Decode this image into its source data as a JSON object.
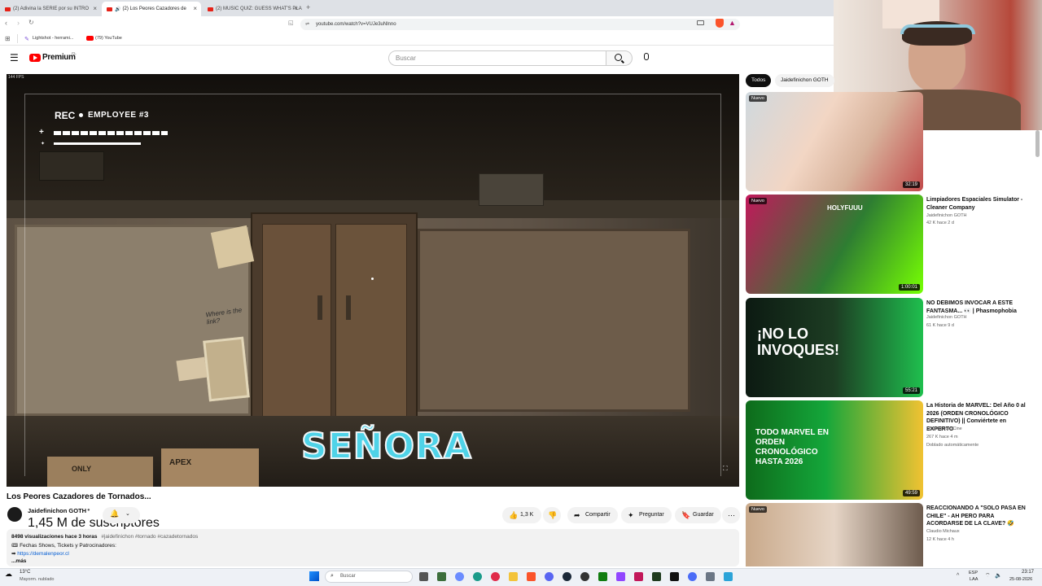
{
  "browser": {
    "tabs": [
      {
        "title": "(2) Adivina la SERIE por su INTRO"
      },
      {
        "title": "(2) Los Peores Cazadores de"
      },
      {
        "title": "(2) MUSIC QUIZ: GUESS WHAT'S PLA"
      }
    ],
    "url": "youtube.com/watch?v=VUJe3uNlnno",
    "bookmarks": [
      "Lightshot - herrami...",
      "(79) YouTube"
    ]
  },
  "youtube": {
    "logo_text": "Premium",
    "logo_region": "CL",
    "search_placeholder": "Buscar"
  },
  "player": {
    "fps": "144 FPS",
    "rec_label": "REC",
    "employee_label": "EMPLOYEE #3",
    "caption": "SEÑORA",
    "poster_text": "Where is the link?",
    "box_text_1": "APEX",
    "box_text_2": "ONLY"
  },
  "video": {
    "title": "Los Peores Cazadores de Tornados...",
    "channel": "Jaidefinichon GOTH",
    "subscribers": "1,45 M de suscriptores",
    "likes": "1,3 K",
    "share": "Compartir",
    "ask": "Preguntar",
    "save": "Guardar",
    "views_time": "8498 visualizaciones  hace 3 horas",
    "hashtags": "#jaidefinichon #tornado #cazadetornados",
    "desc_line1": "Fechas Shows, Tickets y Patrocinadores:",
    "desc_link": "https://demalenpeor.cl",
    "more": "...más"
  },
  "sidebar": {
    "chips": [
      "Todos",
      "Jaidefinichon GOTH"
    ],
    "items": [
      {
        "title": "",
        "channel": "",
        "stats": "",
        "duration": "32:19",
        "badge": "Nuevo"
      },
      {
        "title": "Limpiadores Espaciales Simulator - Cleaner Company",
        "channel": "Jaidefinichon GOTH",
        "stats": "42 K  hace 2 d",
        "duration": "1:00:01",
        "badge": "Nuevo",
        "thumb_text": "HOLYFUUU"
      },
      {
        "title": "NO DEBIMOS INVOCAR A ESTE FANTASMA... 👀 | Phasmophobia",
        "channel": "Jaidefinichon GOTH",
        "stats": "61 K  hace 9 d",
        "duration": "55:21",
        "badge": "",
        "thumb_text": "¡NO LO INVOQUES!"
      },
      {
        "title": "La Historia de MARVEL: Del Año 0 al 2026 (ORDEN CRONOLÓGICO DEFINITIVO) || Conviértete en EXPERTO",
        "channel": "Lo Chido del Cine",
        "stats": "267 K  hace 4 m",
        "extra": "Doblado automáticamente",
        "duration": "49:59",
        "badge": "",
        "thumb_text": "TODO MARVEL EN ORDEN CRONOLÓGICO HASTA 2026"
      },
      {
        "title": "REACCIONANDO A \"SOLO PASA EN CHILE\" - AH PERO PARA ACORDARSE DE LA CLAVE? 🤣",
        "channel": "Claudio Michaux",
        "stats": "12 K  hace 4 h",
        "duration": "",
        "badge": "Nuevo"
      }
    ]
  },
  "taskbar": {
    "weather_temp": "13°C",
    "weather_desc": "Mayorm. nublado",
    "search": "Buscar",
    "lang": "ESP",
    "lang2": "LAA",
    "time": "23:17",
    "date": "25-08-2026"
  },
  "colors": {
    "yt_red": "#ff0000",
    "taskbar_bg": "#eef1f6",
    "tab_bar": "#dee1e6"
  }
}
